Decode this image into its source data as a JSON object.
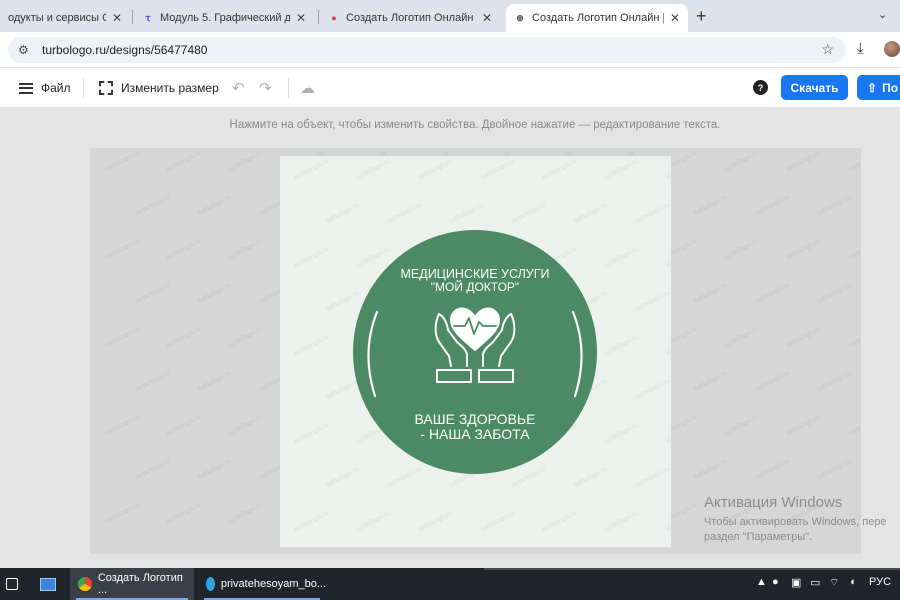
{
  "browser": {
    "tabs": [
      {
        "title": "одукты и сервисы Goog",
        "close": "✕"
      },
      {
        "title": "Модуль 5. Графический дизай",
        "close": "✕"
      },
      {
        "title": "Создать Логотип Онлайн | Бес",
        "close": "✕"
      },
      {
        "title": "Создать Логотип Онлайн | Бес",
        "close": "✕"
      }
    ],
    "new_tab": "+",
    "tab_menu": "⌄",
    "url": "turbologo.ru/designs/56477480"
  },
  "toolbar": {
    "file_label": "Файл",
    "resize_label": "Изменить размер",
    "download_label": "Скачать",
    "share_label": "По"
  },
  "hint": "Нажмите на объект, чтобы изменить свойства. Двойное нажатие — редактирование текста.",
  "logo": {
    "title_line1": "МЕДИЦИНСКИЕ УСЛУГИ",
    "title_line2": "\"МОЙ ДОКТОР\"",
    "slogan_line1": "ВАШЕ ЗДОРОВЬЕ",
    "slogan_line2": "- НАША ЗАБОТА",
    "circle_color": "#4b8a64",
    "text_color": "#ffffff"
  },
  "watermark": "turbologo.ru",
  "windows_activation": {
    "title": "Активация Windows",
    "line1": "Чтобы активировать Windows, пере",
    "line2": "раздел \"Параметры\"."
  },
  "taskbar": {
    "chrome_label": "Создать Логотип ...",
    "telegram_label": "privatehesoyam_bo...",
    "lang": "РУС"
  }
}
